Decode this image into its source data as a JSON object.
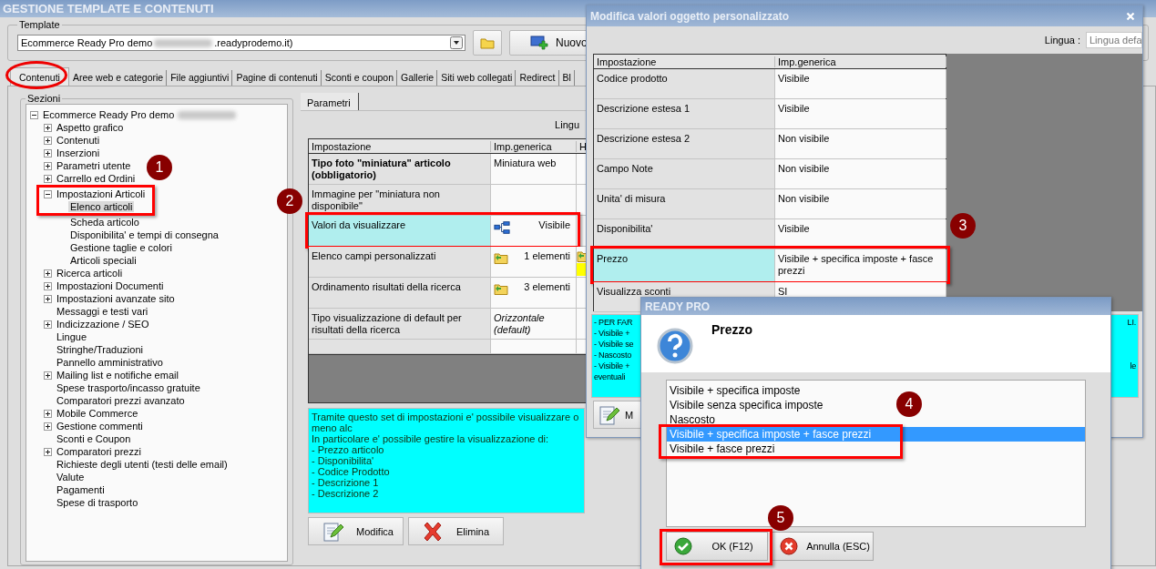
{
  "window": {
    "title": "GESTIONE TEMPLATE E CONTENUTI"
  },
  "template": {
    "label": "Template",
    "value_start": "Ecommerce Ready Pro demo",
    "value_end": ".readyprodemo.it)",
    "new_button": "Nuovo"
  },
  "tabs": [
    {
      "label": "Contenuti",
      "selected": true
    },
    {
      "label": "Aree web e categorie",
      "selected": false
    },
    {
      "label": "File aggiuntivi",
      "selected": false
    },
    {
      "label": "Pagine di contenuti",
      "selected": false
    },
    {
      "label": "Sconti e coupon",
      "selected": false
    },
    {
      "label": "Gallerie",
      "selected": false
    },
    {
      "label": "Siti web collegati",
      "selected": false
    },
    {
      "label": "Redirect",
      "selected": false
    },
    {
      "label": "Bl",
      "selected": false
    }
  ],
  "sections": {
    "label": "Sezioni",
    "items": [
      {
        "label": "Ecommerce Ready Pro demo",
        "kind": "node",
        "expanded": true,
        "selected": false,
        "children": [
          {
            "label": "Aspetto grafico",
            "kind": "node",
            "expanded": false,
            "selected": false
          },
          {
            "label": "Contenuti",
            "kind": "node",
            "expanded": false,
            "selected": false
          },
          {
            "label": "Inserzioni",
            "kind": "node",
            "expanded": false,
            "selected": false
          },
          {
            "label": "Parametri utente",
            "kind": "node",
            "expanded": false,
            "selected": false
          },
          {
            "label": "Carrello ed Ordini",
            "kind": "node",
            "expanded": false,
            "selected": false
          },
          {
            "label": "Impostazioni Articoli",
            "kind": "node",
            "expanded": true,
            "selected": false,
            "children": [
              {
                "label": "Elenco articoli",
                "kind": "leaf",
                "selected": true
              },
              {
                "label": "Scheda articolo",
                "kind": "leaf",
                "selected": false
              },
              {
                "label": "Disponibilita' e tempi di consegna",
                "kind": "leaf",
                "selected": false
              },
              {
                "label": "Gestione taglie e colori",
                "kind": "leaf",
                "selected": false
              },
              {
                "label": "Articoli speciali",
                "kind": "leaf",
                "selected": false
              }
            ]
          },
          {
            "label": "Ricerca articoli",
            "kind": "node",
            "expanded": false,
            "selected": false
          },
          {
            "label": "Impostazioni Documenti",
            "kind": "node",
            "expanded": false,
            "selected": false
          },
          {
            "label": "Impostazioni avanzate sito",
            "kind": "node",
            "expanded": false,
            "selected": false
          },
          {
            "label": "Messaggi e testi vari",
            "kind": "leaf",
            "selected": false
          },
          {
            "label": "Indicizzazione / SEO",
            "kind": "node",
            "expanded": false,
            "selected": false
          },
          {
            "label": "Lingue",
            "kind": "leaf",
            "selected": false
          },
          {
            "label": "Stringhe/Traduzioni",
            "kind": "leaf",
            "selected": false
          },
          {
            "label": "Pannello amministrativo",
            "kind": "leaf",
            "selected": false
          },
          {
            "label": "Mailing list e notifiche email",
            "kind": "node",
            "expanded": false,
            "selected": false
          },
          {
            "label": "Spese trasporto/incasso gratuite",
            "kind": "leaf",
            "selected": false
          },
          {
            "label": "Comparatori prezzi avanzato",
            "kind": "leaf",
            "selected": false
          },
          {
            "label": "Mobile Commerce",
            "kind": "node",
            "expanded": false,
            "selected": false
          },
          {
            "label": "Gestione commenti",
            "kind": "node",
            "expanded": false,
            "selected": false
          },
          {
            "label": "Sconti e Coupon",
            "kind": "leaf",
            "selected": false
          },
          {
            "label": "Comparatori prezzi",
            "kind": "node",
            "expanded": false,
            "selected": false
          },
          {
            "label": "Richieste degli utenti (testi delle email)",
            "kind": "leaf",
            "selected": false
          },
          {
            "label": "Valute",
            "kind": "leaf",
            "selected": false
          },
          {
            "label": "Pagamenti",
            "kind": "leaf",
            "selected": false
          },
          {
            "label": "Spese di trasporto",
            "kind": "leaf",
            "selected": false
          }
        ]
      }
    ]
  },
  "parameters": {
    "tab": "Parametri",
    "language_label": "Lingu",
    "columns": [
      "Impostazione",
      "Imp.generica",
      "H"
    ],
    "rows": [
      {
        "setting": "Tipo foto \"miniatura\" articolo (obbligatorio)",
        "bold": true,
        "value": "Miniatura web",
        "kind": "text",
        "selected": false
      },
      {
        "setting": "Immagine per \"miniatura non disponibile\"",
        "bold": false,
        "kind": "empty",
        "selected": false
      },
      {
        "setting": "Valori da visualizzare",
        "bold": false,
        "value": "Visibile",
        "kind": "structure",
        "selected": true
      },
      {
        "setting": "Elenco campi personalizzati",
        "bold": false,
        "value": "1 elementi",
        "kind": "folder",
        "column_3": {
          "kind": "folder"
        },
        "selected": false
      },
      {
        "setting": "Ordinamento risultati della ricerca",
        "bold": false,
        "value": "3 elementi",
        "kind": "folder",
        "selected": false
      },
      {
        "setting": "Tipo visualizzazione di default per risultati della ricerca",
        "bold": false,
        "value": "Orizzontale (default)",
        "kind": "italic",
        "selected": false
      }
    ],
    "description": [
      "Tramite questo set di impostazioni e' possibile visualizzare o meno alc",
      "In particolare e' possibile gestire la visualizzazione di:",
      "- Prezzo articolo",
      "- Disponibilita'",
      "- Codice Prodotto",
      "- Descrizione 1",
      "- Descrizione 2"
    ],
    "buttons": [
      {
        "label": "Modifica",
        "kind": "edit"
      },
      {
        "label": "Elimina",
        "kind": "delete"
      }
    ]
  },
  "custom_dialog": {
    "title": "Modifica valori oggetto personalizzato",
    "language_label": "Lingua :",
    "language_value": "Lingua defa",
    "columns": [
      "Impostazione",
      "Imp.generica"
    ],
    "rows": [
      {
        "setting": "Codice prodotto",
        "value": "Visibile",
        "selected": false
      },
      {
        "setting": "Descrizione estesa 1",
        "value": "Visibile",
        "selected": false
      },
      {
        "setting": "Descrizione estesa 2",
        "value": "Non visibile",
        "selected": false
      },
      {
        "setting": "Campo Note",
        "value": "Non visibile",
        "selected": false
      },
      {
        "setting": "Unita' di misura",
        "value": "Non visibile",
        "selected": false
      },
      {
        "setting": "Disponibilita'",
        "value": "Visibile",
        "selected": false
      },
      {
        "setting": "Prezzo",
        "value": "Visibile + specifica imposte + fasce prezzi",
        "selected": true
      },
      {
        "setting": "Visualizza sconti",
        "value": "SI",
        "selected": false
      }
    ],
    "notes": [
      {
        "left": "- PER FAR",
        "right": "LI."
      },
      {
        "left": "- Visibile +"
      },
      {
        "left": "- Visibile se"
      },
      {
        "left": "- Nascosto"
      },
      {
        "left": "- Visibile +",
        "right": "le"
      },
      {
        "left": "eventuali"
      }
    ],
    "button": {
      "label": "M",
      "kind": "edit"
    }
  },
  "choice_dialog": {
    "title": "READY PRO",
    "heading": "Prezzo",
    "options": [
      {
        "label": "Visibile + specifica imposte",
        "selected": false
      },
      {
        "label": "Visibile senza specifica imposte",
        "selected": false
      },
      {
        "label": "Nascosto",
        "selected": false
      },
      {
        "label": "Visibile + specifica imposte + fasce prezzi",
        "selected": true
      },
      {
        "label": "Visibile + fasce prezzi",
        "selected": false
      }
    ],
    "buttons": [
      {
        "label": "OK (F12)",
        "kind": "ok"
      },
      {
        "label": "Annulla (ESC)",
        "kind": "cancel"
      }
    ]
  },
  "annotations": {
    "markers": [
      "1",
      "2",
      "3",
      "4",
      "5"
    ]
  }
}
